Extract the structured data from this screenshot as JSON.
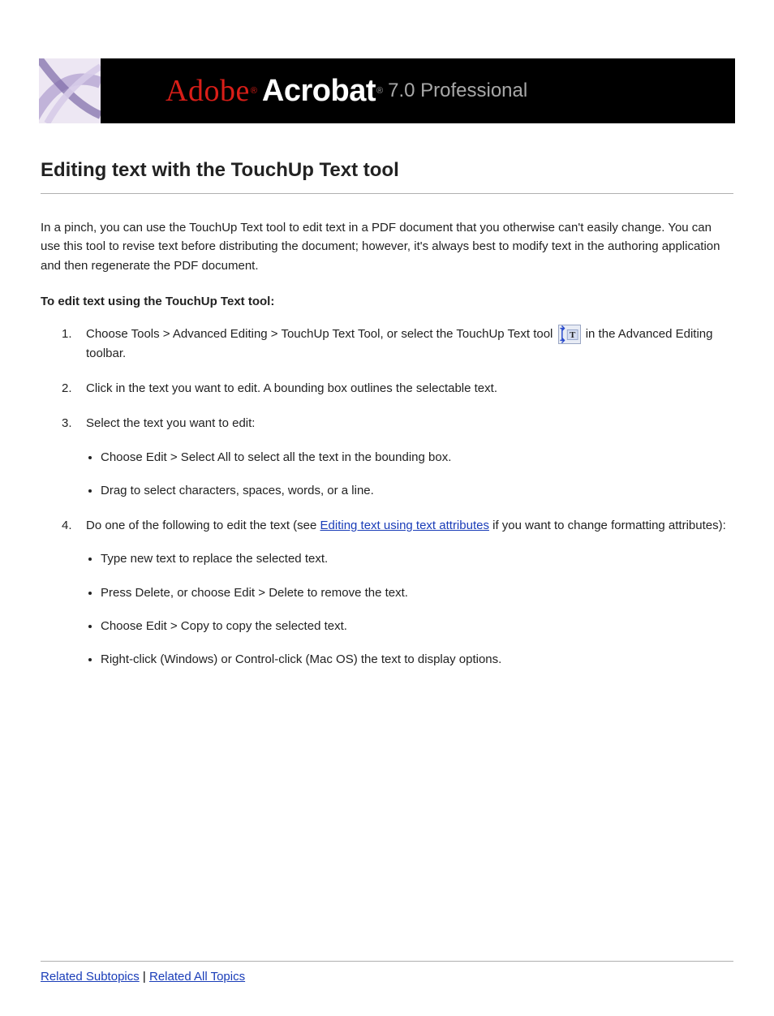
{
  "banner": {
    "brand_adobe": "Adobe",
    "reg1": "®",
    "brand_acrobat": "Acrobat",
    "reg2": "®",
    "version": "7.0 Professional"
  },
  "title": "Editing text with the TouchUp Text tool",
  "intro": "In a pinch, you can use the TouchUp Text tool to edit text in a PDF document that you otherwise can't easily change. You can use this tool to revise text before distributing the document; however, it's always best to modify text in the authoring application and then regenerate the PDF document.",
  "subhead": "To edit text using the TouchUp Text tool:",
  "steps": [
    {
      "pre": "Choose Tools > Advanced Editing > TouchUp Text Tool, or select the TouchUp Text tool ",
      "icon_name": "touchup-text-tool-icon",
      "post": " in the Advanced Editing toolbar."
    },
    {
      "text": "Click in the text you want to edit. A bounding box outlines the selectable text."
    },
    {
      "text": "Select the text you want to edit:",
      "sub": [
        "Choose Edit > Select All to select all the text in the bounding box.",
        "Drag to select characters, spaces, words, or a line."
      ]
    },
    {
      "pre": "Do one of the following to edit the text (see ",
      "link": "Editing text using text attributes",
      "post": " if you want to change formatting attributes):",
      "sub": [
        "Type new text to replace the selected text.",
        "Press Delete, or choose Edit > Delete to remove the text.",
        "Choose Edit > Copy to copy the selected text.",
        "Right-click (Windows) or Control-click (Mac OS) the text to display options."
      ]
    }
  ],
  "footer": {
    "related": "Related Subtopics",
    "sep": " | ",
    "all": "Related All Topics"
  }
}
